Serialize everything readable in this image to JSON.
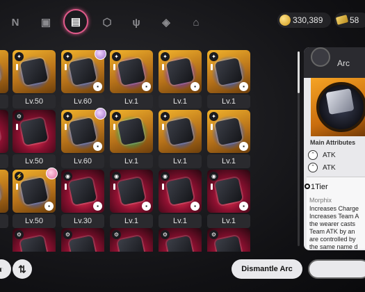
{
  "topbar": {
    "tabs": [
      {
        "name": "tab-logo",
        "glyph": "N"
      },
      {
        "name": "tab-device",
        "glyph": "▣"
      },
      {
        "name": "tab-arc",
        "glyph": "▤"
      },
      {
        "name": "tab-box",
        "glyph": "⬡"
      },
      {
        "name": "tab-food",
        "glyph": "ψ"
      },
      {
        "name": "tab-cube",
        "glyph": "◈"
      },
      {
        "name": "tab-home",
        "glyph": "⌂"
      }
    ],
    "gold": "330,389",
    "tickets": "58"
  },
  "grid": {
    "rows": [
      [
        "Lv.50",
        "Lv.60",
        "Lv.1",
        "Lv.1",
        "Lv.1"
      ],
      [
        "Lv.50",
        "Lv.60",
        "Lv.1",
        "Lv.1",
        "Lv.1"
      ],
      [
        "Lv.50",
        "Lv.30",
        "Lv.1",
        "Lv.1",
        "Lv.1"
      ]
    ]
  },
  "panel": {
    "title": "Arc",
    "main_attributes_title": "Main Attributes",
    "attributes": [
      "ATK",
      "ATK"
    ],
    "tier": "1Tier",
    "set_name": "Morphix",
    "description_lines": [
      "Increases Charge",
      "Increases Team A",
      "the wearer casts",
      "Team ATK by an",
      "are controlled by",
      "the same name d"
    ]
  },
  "buttons": {
    "dismantle": "Dismantle Arc",
    "sort_glyph": "⇅",
    "left_glyph": "◐"
  }
}
